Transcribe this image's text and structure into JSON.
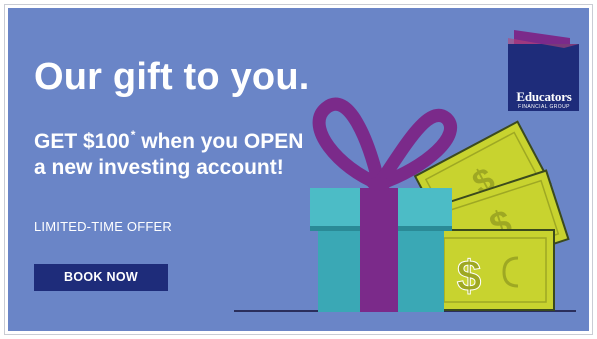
{
  "ad": {
    "headline": "Our gift to you.",
    "offer_amount": "GET $100",
    "offer_asterisk": "*",
    "offer_rest": " when you OPEN a new investing account!",
    "limited": "LIMITED-TIME OFFER",
    "button_label": "BOOK NOW"
  },
  "brand": {
    "name": "Educators",
    "tagline": "FINANCIAL GROUP"
  },
  "colors": {
    "background": "#6a85c7",
    "button": "#1e2c7a",
    "logo": "#1e2c7a",
    "gift_box": "#3aa8b5",
    "ribbon": "#7b2a8a",
    "money": "#c8d32f"
  }
}
